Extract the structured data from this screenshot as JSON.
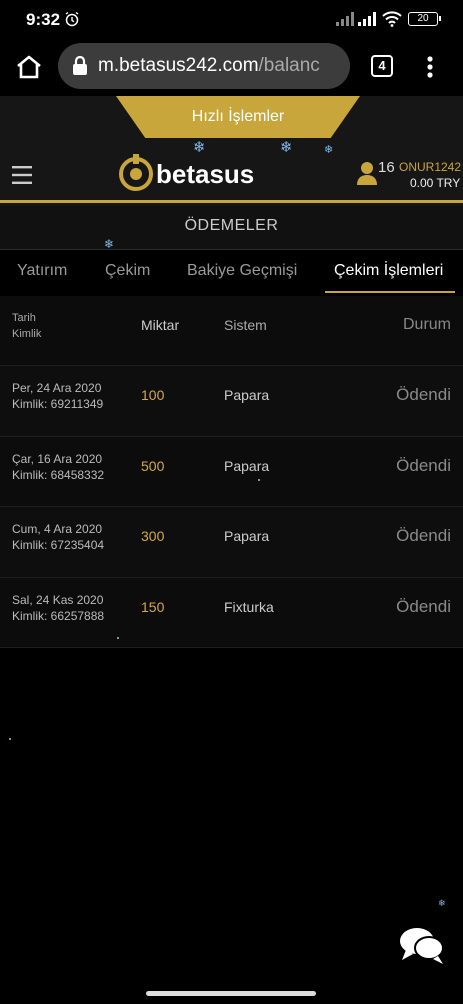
{
  "status_bar": {
    "time": "9:32",
    "battery": "20"
  },
  "browser": {
    "url_host": "m.betasus242.com",
    "url_path": "/balanc",
    "tab_count": "4"
  },
  "header": {
    "quick_label": "Hızlı İşlemler",
    "logo_text": "betasus",
    "user_count": "16",
    "username": "ONUR1242",
    "balance": "0.00 TRY"
  },
  "page": {
    "title": "ÖDEMELER"
  },
  "tabs": [
    {
      "label": "Yatırım",
      "active": false
    },
    {
      "label": "Çekim",
      "active": false
    },
    {
      "label": "Bakiye Geçmişi",
      "active": false
    },
    {
      "label": "Çekim İşlemleri",
      "active": true
    }
  ],
  "table": {
    "headers": {
      "date": "Tarih",
      "id": "Kimlik",
      "amount": "Miktar",
      "system": "Sistem",
      "status": "Durum"
    },
    "rows": [
      {
        "date": "Per, 24 Ara 2020",
        "id": "Kimlik: 69211349",
        "amount": "100",
        "system": "Papara",
        "status": "Ödendi"
      },
      {
        "date": "Çar, 16 Ara 2020",
        "id": "Kimlik: 68458332",
        "amount": "500",
        "system": "Papara",
        "status": "Ödendi"
      },
      {
        "date": "Cum, 4 Ara 2020",
        "id": "Kimlik: 67235404",
        "amount": "300",
        "system": "Papara",
        "status": "Ödendi"
      },
      {
        "date": "Sal, 24 Kas 2020",
        "id": "Kimlik: 66257888",
        "amount": "150",
        "system": "Fixturka",
        "status": "Ödendi"
      }
    ]
  },
  "colors": {
    "accent": "#c9a63c",
    "background": "#000000",
    "panel": "#161616"
  }
}
